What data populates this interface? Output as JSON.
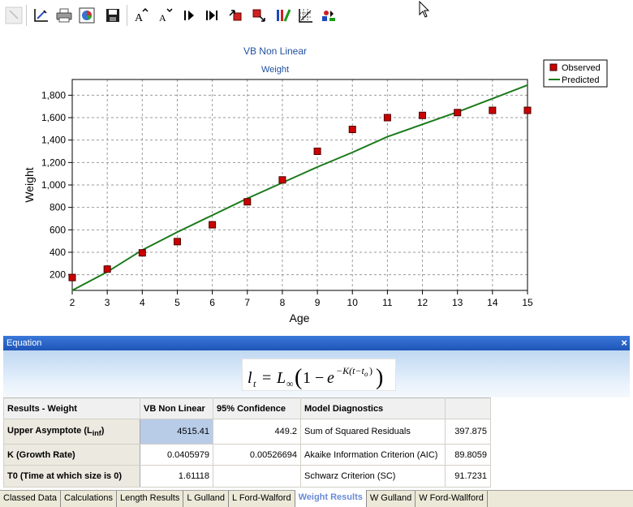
{
  "chart_data": {
    "type": "scatter",
    "title": "VB Non Linear",
    "subtitle": "Weight",
    "xlabel": "Age",
    "ylabel": "Weight",
    "xlim": [
      2,
      15
    ],
    "ylim": [
      60,
      1940
    ],
    "x_ticks": [
      "2",
      "3",
      "4",
      "5",
      "6",
      "7",
      "8",
      "9",
      "10",
      "11",
      "12",
      "13",
      "14",
      "15"
    ],
    "y_ticks": [
      "200",
      "400",
      "600",
      "800",
      "1,000",
      "1,200",
      "1,400",
      "1,600",
      "1,800"
    ],
    "y_tick_values": [
      200,
      400,
      600,
      800,
      1000,
      1200,
      1400,
      1600,
      1800
    ],
    "grid": true,
    "legend": "top-right",
    "series": [
      {
        "name": "Observed",
        "kind": "points",
        "color": "#cc0000",
        "x": [
          2,
          3,
          4,
          5,
          6,
          7,
          8,
          9,
          10,
          11,
          12,
          13,
          14,
          15
        ],
        "values": [
          175,
          250,
          395,
          495,
          645,
          850,
          1045,
          1300,
          1495,
          1600,
          1620,
          1645,
          1665,
          1665
        ]
      },
      {
        "name": "Predicted",
        "kind": "line",
        "color": "#1a7a1a",
        "x": [
          2,
          3,
          4,
          5,
          6,
          7,
          8,
          9,
          10,
          11,
          12,
          13,
          14,
          15
        ],
        "values": [
          60,
          225,
          420,
          580,
          730,
          880,
          1020,
          1160,
          1290,
          1430,
          1540,
          1650,
          1770,
          1890
        ]
      }
    ]
  },
  "equation": {
    "header": "Equation",
    "close": "×",
    "formula_alt": "l_t = L_inf (1 - e^(-K(t - t_0)))"
  },
  "results": {
    "headers": [
      "Results - Weight",
      "VB Non Linear",
      "95% Confidence",
      "Model Diagnostics",
      ""
    ],
    "rows": [
      {
        "label": "Upper Asymptote (L",
        "label_sub": "inf",
        "label_end": ")",
        "value": "4515.41",
        "conf": "449.2",
        "diag": "Sum of Squared Residuals",
        "diag_value": "397.875"
      },
      {
        "label": "K (Growth Rate)",
        "value": "0.0405979",
        "conf": "0.00526694",
        "diag": "Akaike Information Criterion (AIC)",
        "diag_value": "89.8059"
      },
      {
        "label": "T0 (Time at which size is 0)",
        "value": "1.61118",
        "conf": "",
        "diag": "Schwarz Criterion (SC)",
        "diag_value": "91.7231"
      }
    ]
  },
  "tabs": [
    {
      "label": "Classed Data",
      "active": false
    },
    {
      "label": "Calculations",
      "active": false
    },
    {
      "label": "Length Results",
      "active": false
    },
    {
      "label": "L Gulland",
      "active": false
    },
    {
      "label": "L Ford-Walford",
      "active": false
    },
    {
      "label": "Weight Results",
      "active": true
    },
    {
      "label": "W Gulland",
      "active": false
    },
    {
      "label": "W Ford-Wallford",
      "active": false
    }
  ],
  "toolbar": {
    "icons": [
      "pointer-icon",
      "chart-edit-icon",
      "print-icon",
      "chart-wizard-icon",
      "save-icon",
      "font-increase-icon",
      "font-decrease-icon",
      "step-forward-icon",
      "step-end-icon",
      "move-up-icon",
      "move-down-icon",
      "series-colors-icon",
      "grid-icon",
      "properties-icon"
    ]
  }
}
